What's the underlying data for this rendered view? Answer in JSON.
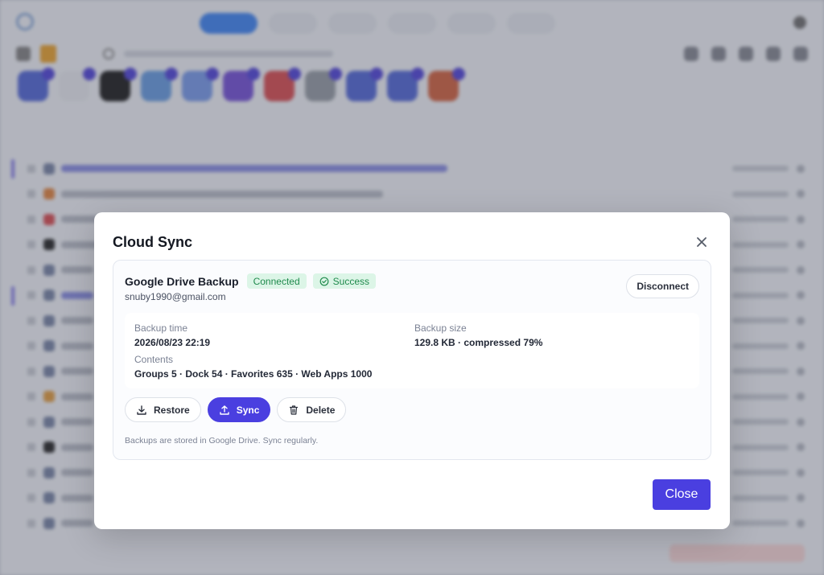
{
  "modal": {
    "title": "Cloud Sync",
    "close_button": "Close",
    "provider": {
      "name": "Google Drive Backup",
      "status_badge": "Connected",
      "result_badge": "Success",
      "account": "snuby1990@gmail.com",
      "disconnect_label": "Disconnect"
    },
    "details": {
      "backup_time_label": "Backup time",
      "backup_time_value": "2026/08/23 22:19",
      "backup_size_label": "Backup size",
      "backup_size_value": "129.8 KB · compressed 79%",
      "contents_label": "Contents",
      "contents_value": "Groups 5 · Dock 54 · Favorites 635 · Web Apps 1000"
    },
    "actions": {
      "restore_label": "Restore",
      "sync_label": "Sync",
      "delete_label": "Delete"
    },
    "hint": "Backups are stored in Google Drive. Sync regularly."
  },
  "colors": {
    "accent": "#4a3fe0",
    "success_bg": "#dcf5e7",
    "success_text": "#1f8a4c"
  },
  "icons": {
    "close": "close-icon",
    "success": "check-circle-icon",
    "restore": "download-icon",
    "sync": "upload-icon",
    "delete": "trash-icon"
  }
}
